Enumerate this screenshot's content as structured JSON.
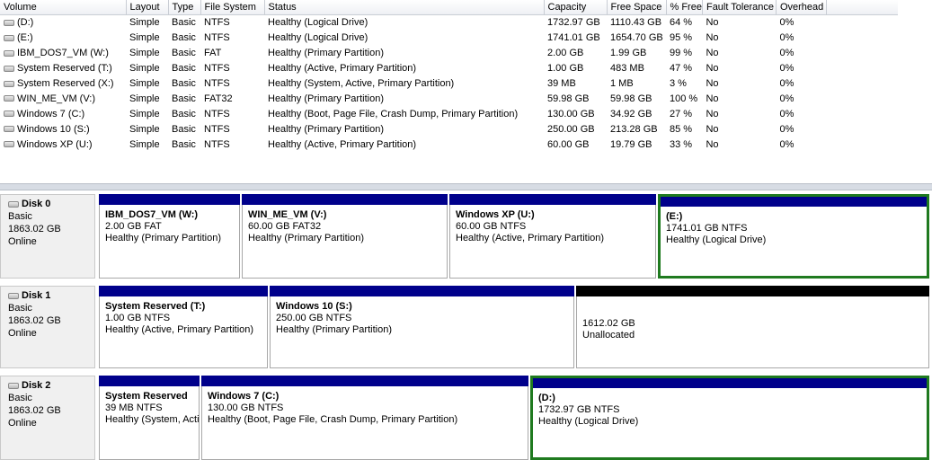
{
  "columns": [
    "Volume",
    "Layout",
    "Type",
    "File System",
    "Status",
    "Capacity",
    "Free Space",
    "% Free",
    "Fault Tolerance",
    "Overhead"
  ],
  "volumes": [
    {
      "volume": "(D:)",
      "layout": "Simple",
      "type": "Basic",
      "fs": "NTFS",
      "status": "Healthy (Logical Drive)",
      "capacity": "1732.97 GB",
      "free": "1110.43 GB",
      "pct": "64 %",
      "fault": "No",
      "overhead": "0%"
    },
    {
      "volume": "(E:)",
      "layout": "Simple",
      "type": "Basic",
      "fs": "NTFS",
      "status": "Healthy (Logical Drive)",
      "capacity": "1741.01 GB",
      "free": "1654.70 GB",
      "pct": "95 %",
      "fault": "No",
      "overhead": "0%"
    },
    {
      "volume": "IBM_DOS7_VM (W:)",
      "layout": "Simple",
      "type": "Basic",
      "fs": "FAT",
      "status": "Healthy (Primary Partition)",
      "capacity": "2.00 GB",
      "free": "1.99 GB",
      "pct": "99 %",
      "fault": "No",
      "overhead": "0%"
    },
    {
      "volume": "System Reserved (T:)",
      "layout": "Simple",
      "type": "Basic",
      "fs": "NTFS",
      "status": "Healthy (Active, Primary Partition)",
      "capacity": "1.00 GB",
      "free": "483 MB",
      "pct": "47 %",
      "fault": "No",
      "overhead": "0%"
    },
    {
      "volume": "System Reserved (X:)",
      "layout": "Simple",
      "type": "Basic",
      "fs": "NTFS",
      "status": "Healthy (System, Active, Primary Partition)",
      "capacity": "39 MB",
      "free": "1 MB",
      "pct": "3 %",
      "fault": "No",
      "overhead": "0%"
    },
    {
      "volume": "WIN_ME_VM (V:)",
      "layout": "Simple",
      "type": "Basic",
      "fs": "FAT32",
      "status": "Healthy (Primary Partition)",
      "capacity": "59.98 GB",
      "free": "59.98 GB",
      "pct": "100 %",
      "fault": "No",
      "overhead": "0%"
    },
    {
      "volume": "Windows 7 (C:)",
      "layout": "Simple",
      "type": "Basic",
      "fs": "NTFS",
      "status": "Healthy (Boot, Page File, Crash Dump, Primary Partition)",
      "capacity": "130.00 GB",
      "free": "34.92 GB",
      "pct": "27 %",
      "fault": "No",
      "overhead": "0%"
    },
    {
      "volume": "Windows 10 (S:)",
      "layout": "Simple",
      "type": "Basic",
      "fs": "NTFS",
      "status": "Healthy (Primary Partition)",
      "capacity": "250.00 GB",
      "free": "213.28 GB",
      "pct": "85 %",
      "fault": "No",
      "overhead": "0%"
    },
    {
      "volume": "Windows XP (U:)",
      "layout": "Simple",
      "type": "Basic",
      "fs": "NTFS",
      "status": "Healthy (Active, Primary Partition)",
      "capacity": "60.00 GB",
      "free": "19.79 GB",
      "pct": "33 %",
      "fault": "No",
      "overhead": "0%"
    }
  ],
  "disks": [
    {
      "name": "Disk 0",
      "kind": "Basic",
      "size": "1863.02 GB",
      "state": "Online",
      "partitions": [
        {
          "name": "IBM_DOS7_VM  (W:)",
          "size": "2.00 GB FAT",
          "status": "Healthy (Primary Partition)",
          "bar": "primary"
        },
        {
          "name": "WIN_ME_VM  (V:)",
          "size": "60.00 GB FAT32",
          "status": "Healthy (Primary Partition)",
          "bar": "primary"
        },
        {
          "name": "Windows XP  (U:)",
          "size": "60.00 GB NTFS",
          "status": "Healthy (Active, Primary Partition)",
          "bar": "primary"
        },
        {
          "name": "(E:)",
          "size": "1741.01 GB NTFS",
          "status": "Healthy (Logical Drive)",
          "bar": "primary",
          "selected": true
        }
      ]
    },
    {
      "name": "Disk 1",
      "kind": "Basic",
      "size": "1863.02 GB",
      "state": "Online",
      "partitions": [
        {
          "name": "System Reserved  (T:)",
          "size": "1.00 GB NTFS",
          "status": "Healthy (Active, Primary Partition)",
          "bar": "primary"
        },
        {
          "name": "Windows 10  (S:)",
          "size": "250.00 GB NTFS",
          "status": "Healthy (Primary Partition)",
          "bar": "primary"
        },
        {
          "name": "",
          "size": "1612.02 GB",
          "status": "Unallocated",
          "bar": "unallocated"
        }
      ]
    },
    {
      "name": "Disk 2",
      "kind": "Basic",
      "size": "1863.02 GB",
      "state": "Online",
      "partitions": [
        {
          "name": "System Reserved",
          "size": "39 MB NTFS",
          "status": "Healthy (System, Active, Primary Partition)",
          "bar": "primary"
        },
        {
          "name": "Windows 7  (C:)",
          "size": "130.00 GB NTFS",
          "status": "Healthy (Boot, Page File, Crash Dump, Primary Partition)",
          "bar": "primary"
        },
        {
          "name": "(D:)",
          "size": "1732.97 GB NTFS",
          "status": "Healthy (Logical Drive)",
          "bar": "primary",
          "selected": true
        }
      ]
    }
  ],
  "icons": {
    "drive": "drive-icon",
    "disk": "disk-icon"
  },
  "colors": {
    "primary_bar": "#00008b",
    "unallocated_bar": "#000000",
    "selection": "#1f7a1f",
    "header_bg": "#eef0f4"
  }
}
